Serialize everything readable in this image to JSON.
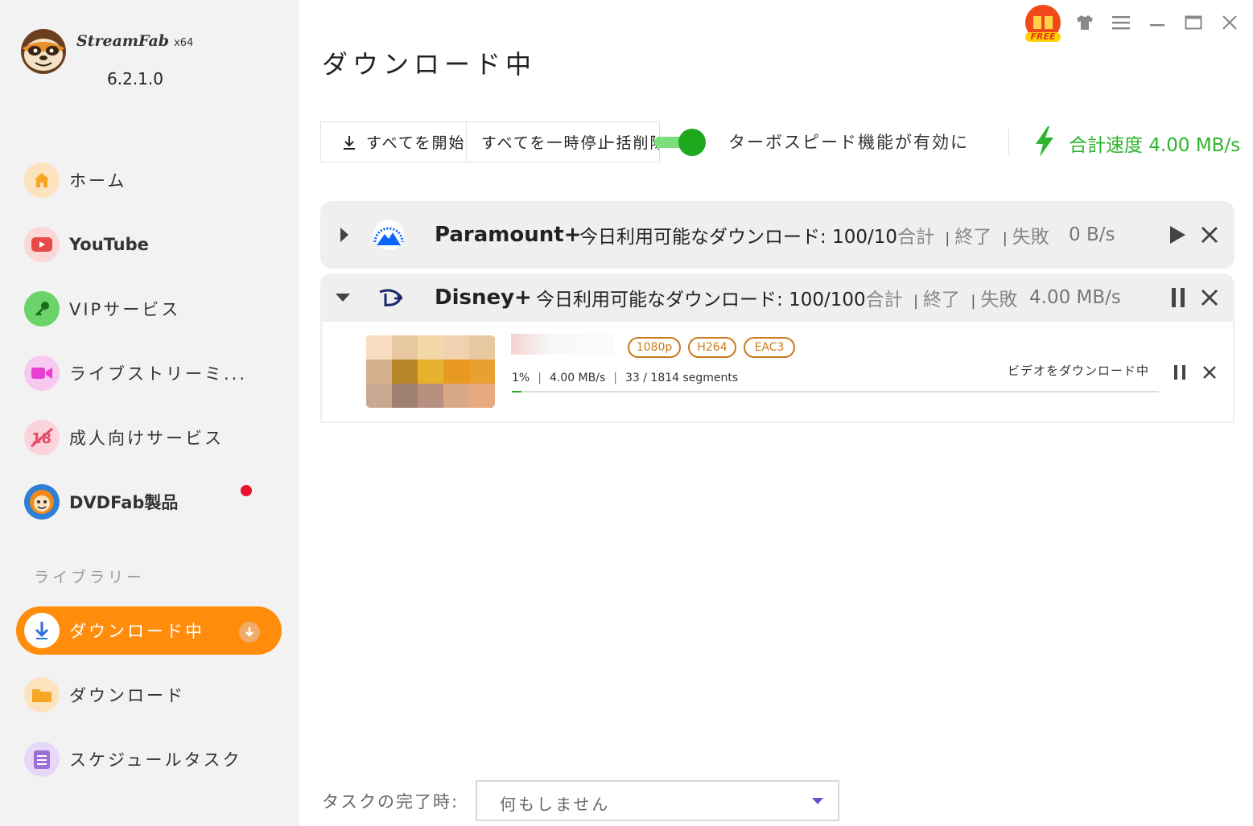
{
  "app": {
    "brand": "StreamFab",
    "arch": "x64",
    "version": "6.2.1.0"
  },
  "sidebar": {
    "items": [
      {
        "label": "ホーム",
        "icon": "home-icon",
        "color": "#f5a623"
      },
      {
        "label": "YouTube",
        "icon": "youtube-icon",
        "color": "#e84a4a"
      },
      {
        "label": "VIPサービス",
        "icon": "key-icon",
        "color": "#3dbb3d"
      },
      {
        "label": "ライブストリーミ...",
        "icon": "video-camera-icon",
        "color": "#e83fcf"
      },
      {
        "label": "成人向けサービス",
        "icon": "adult-18-icon",
        "color": "#e84a6a"
      },
      {
        "label": "DVDFab製品",
        "icon": "dvdfab-icon",
        "color": "#f08a1a"
      }
    ],
    "library_title": "ライブラリー",
    "library_items": [
      {
        "label": "ダウンロード中",
        "icon": "download-arrow-icon",
        "active": true
      },
      {
        "label": "ダウンロード",
        "icon": "folder-icon",
        "color": "#f5a623"
      },
      {
        "label": "スケジュールタスク",
        "icon": "schedule-list-icon",
        "color": "#9b6fd6"
      }
    ]
  },
  "header": {
    "free_badge": "FREE"
  },
  "main": {
    "title": "ダウンロード中",
    "toolbar": {
      "start_all": "すべてを開始",
      "pause_all": "すべてを一時停止",
      "delete_all": "一括削除",
      "turbo_enabled": true,
      "turbo_label": "ターボスピード機能が有効に",
      "total_speed_label": "合計速度",
      "total_speed_value": "4.00 MB/s"
    },
    "groups": [
      {
        "name": "Paramount+",
        "info_label": "今日利用可能なダウンロード:",
        "info_value": "100/10",
        "total": "合計",
        "done": "終了",
        "failed": "失敗",
        "speed": "0 B/s",
        "expanded": false
      },
      {
        "name": "Disney+",
        "info_label": "今日利用可能なダウンロード:",
        "info_value": "100/100",
        "total": "合計",
        "done": "終了",
        "failed": "失敗",
        "speed": "4.00 MB/s",
        "expanded": true
      }
    ],
    "task": {
      "tags": [
        "1080p",
        "H264",
        "EAC3"
      ],
      "percent": "1%",
      "speed": "4.00 MB/s",
      "segments": "33 / 1814 segments",
      "progress": 0.01,
      "status": "ビデオをダウンロード中"
    }
  },
  "footer": {
    "label": "タスクの完了時:",
    "select_value": "何もしません"
  }
}
